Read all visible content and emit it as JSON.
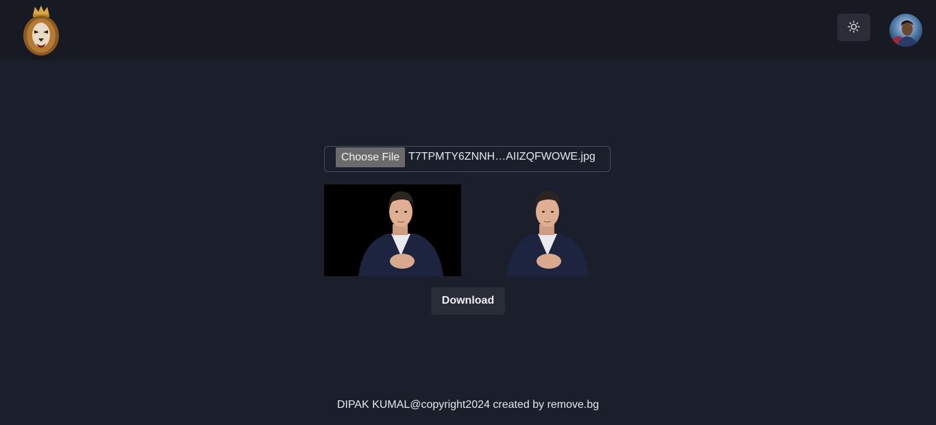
{
  "header": {
    "logo_icon": "crowned-lion-logo",
    "theme_toggle_icon": "sun-icon",
    "avatar_icon": "user-avatar"
  },
  "upload": {
    "choose_label": "Choose File",
    "file_name": "T7TPMTY6ZNNH…AIIZQFWOWE.jpg"
  },
  "preview": {
    "original_icon": "original-photo",
    "result_icon": "background-removed-photo"
  },
  "actions": {
    "download_label": "Download"
  },
  "footer": {
    "text": "DIPAK KUMAL@copyright2024 created by remove.bg"
  },
  "colors": {
    "page_bg": "#1b1f2c",
    "header_bg": "#181a23",
    "button_bg": "#2a2d37",
    "text": "#e6e7ea"
  }
}
